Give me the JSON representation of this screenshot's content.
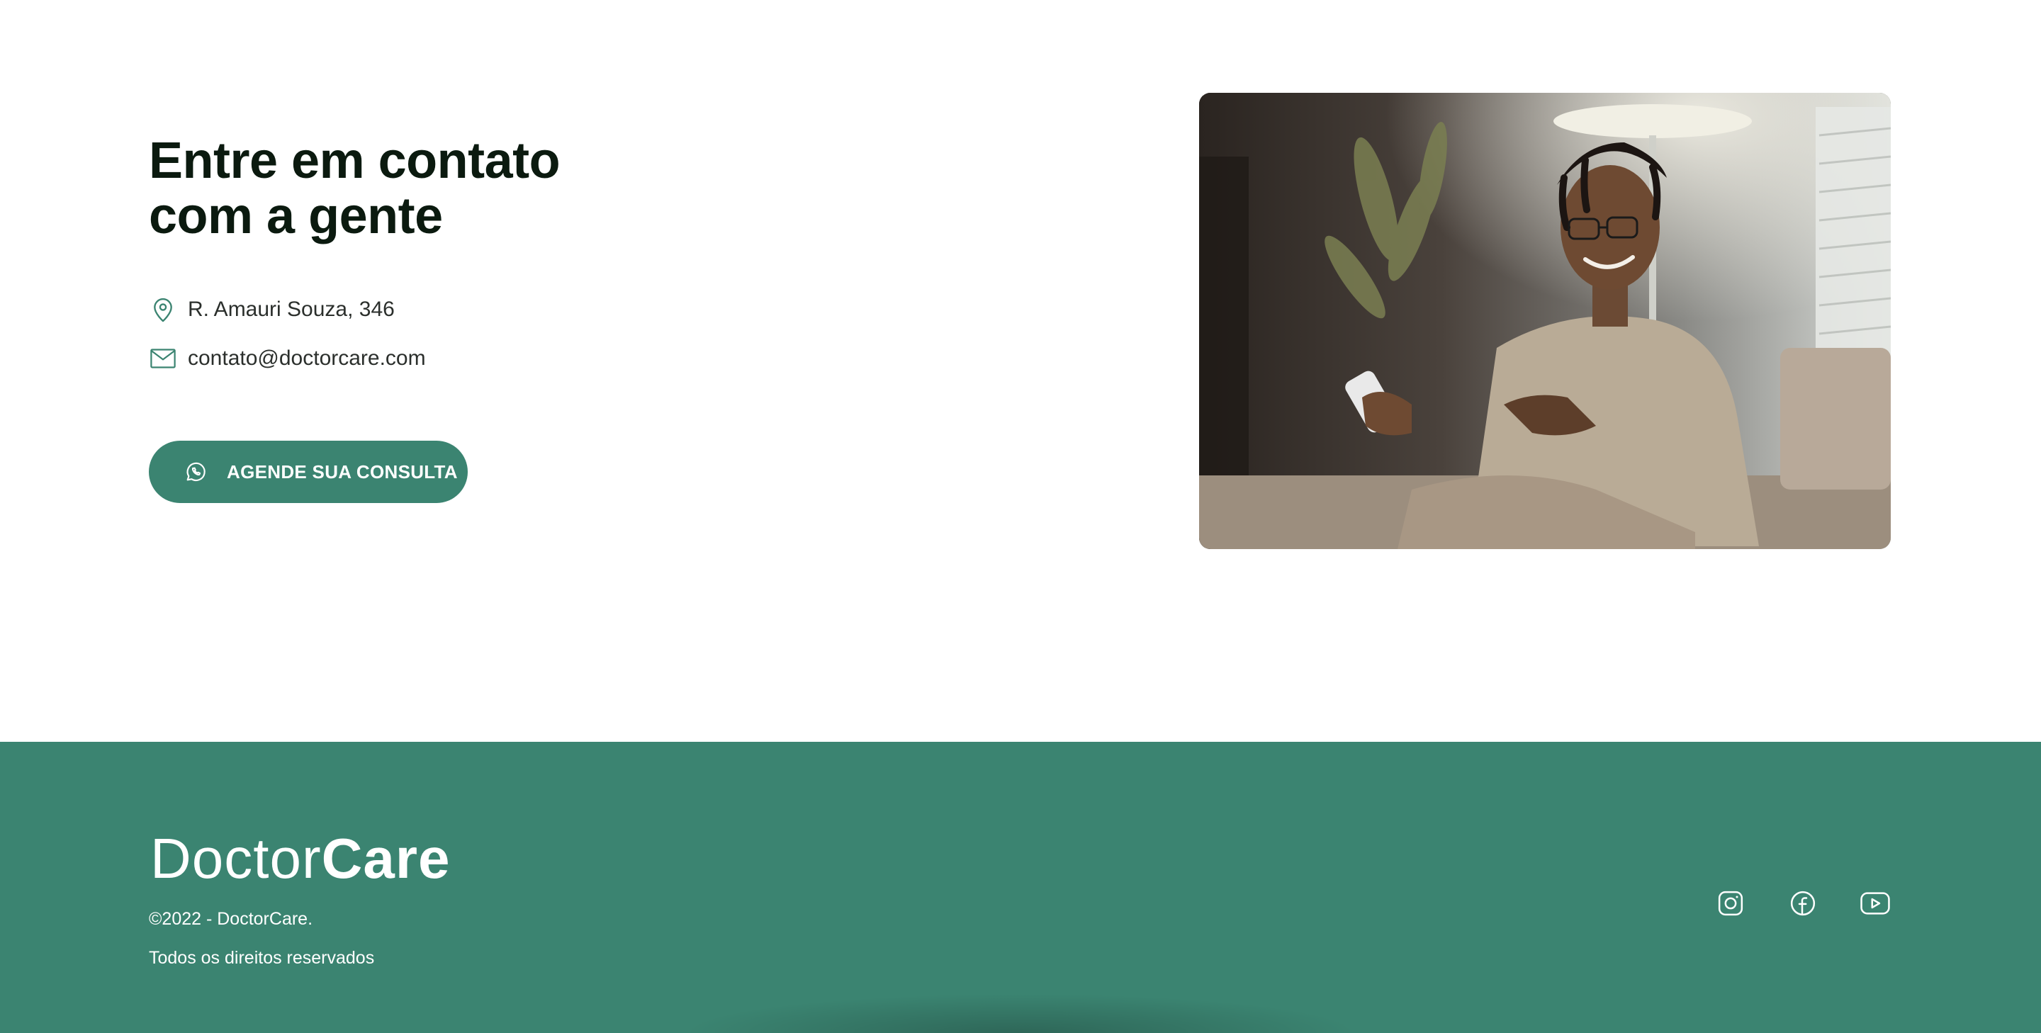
{
  "contact": {
    "heading_line1": "Entre em contato",
    "heading_line2": "com a gente",
    "address": "R. Amauri Souza, 346",
    "address_icon": "map-pin-icon",
    "email": "contato@doctorcare.com",
    "email_icon": "mail-icon",
    "cta_label": "AGENDE SUA CONSULTA",
    "cta_icon": "whatsapp-icon"
  },
  "footer": {
    "logo_light": "Doctor",
    "logo_bold": "Care",
    "copyright": "©2022 - DoctorCare.",
    "rights": "Todos os direitos reservados",
    "social": [
      "instagram-icon",
      "facebook-icon",
      "youtube-icon"
    ]
  },
  "colors": {
    "brand_green": "#3b8471",
    "heading_text": "#0b1a0f",
    "body_text": "#2b2f2c",
    "white": "#ffffff"
  }
}
